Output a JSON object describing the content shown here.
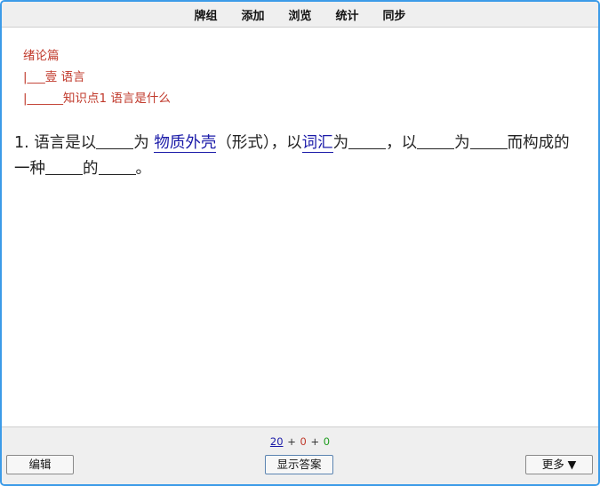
{
  "topbar": {
    "items": [
      {
        "label": "牌组"
      },
      {
        "label": "添加"
      },
      {
        "label": "浏览"
      },
      {
        "label": "统计"
      },
      {
        "label": "同步"
      }
    ]
  },
  "breadcrumb": [
    "绪论篇",
    "|___壹 语言",
    "|______知识点1 语言是什么"
  ],
  "question": {
    "number": "1.",
    "parts": {
      "p1": "语言是以",
      "p2": "为",
      "ans1": "物质外壳",
      "p3": "（形式），以",
      "ans2": "词汇",
      "p4": "为",
      "p5": "，以",
      "p6": "为",
      "p7": "而构成的一种",
      "p8": "的",
      "p9": "。"
    }
  },
  "counts": {
    "new": "20",
    "learn": "0",
    "review": "0",
    "plus": "+"
  },
  "buttons": {
    "edit": "编辑",
    "show_answer": "显示答案",
    "more": "更多 ▼"
  },
  "colors": {
    "border": "#3c9be8",
    "breadcrumb": "#c0392b",
    "answer": "#1a1aa8",
    "review": "#1f9d1f"
  }
}
